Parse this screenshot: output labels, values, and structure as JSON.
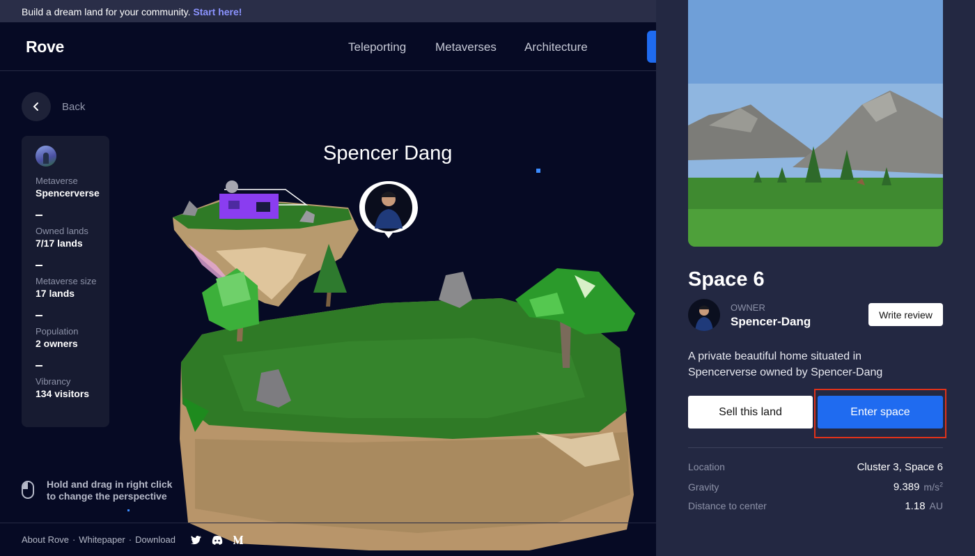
{
  "banner": {
    "text": "Build a dream land for your community.",
    "link": "Start here!"
  },
  "nav": {
    "logo": "Rove",
    "links": [
      "Teleporting",
      "Metaverses",
      "Architecture"
    ]
  },
  "back_label": "Back",
  "stats": {
    "metaverse_label": "Metaverse",
    "metaverse_value": "Spencerverse",
    "owned_label": "Owned lands",
    "owned_value": "7/17 lands",
    "size_label": "Metaverse size",
    "size_value": "17 lands",
    "population_label": "Population",
    "population_value": "2 owners",
    "vibrancy_label": "Vibrancy",
    "vibrancy_value": "134 visitors"
  },
  "scene": {
    "owner_name": "Spencer Dang"
  },
  "hint": "Hold and drag in right click to change the perspective",
  "footer": {
    "about": "About Rove",
    "whitepaper": "Whitepaper",
    "download": "Download",
    "separator": "·"
  },
  "social_icons": [
    "twitter-icon",
    "discord-icon",
    "medium-icon"
  ],
  "panel": {
    "title": "Space 6",
    "owner_label": "OWNER",
    "owner_value": "Spencer-Dang",
    "review_button": "Write review",
    "description": "A private beautiful home situated in Spencerverse owned by Spencer-Dang",
    "sell_button": "Sell this land",
    "enter_button": "Enter space",
    "location_label": "Location",
    "location_value": "Cluster 3, Space 6",
    "gravity_label": "Gravity",
    "gravity_value": "9.389",
    "gravity_unit": "m/s",
    "distance_label": "Distance to center",
    "distance_value": "1.18",
    "distance_unit": "AU"
  },
  "colors": {
    "background": "#060a24",
    "panel": "#232842",
    "accent": "#1f6bf0",
    "highlight": "#e0321a"
  }
}
